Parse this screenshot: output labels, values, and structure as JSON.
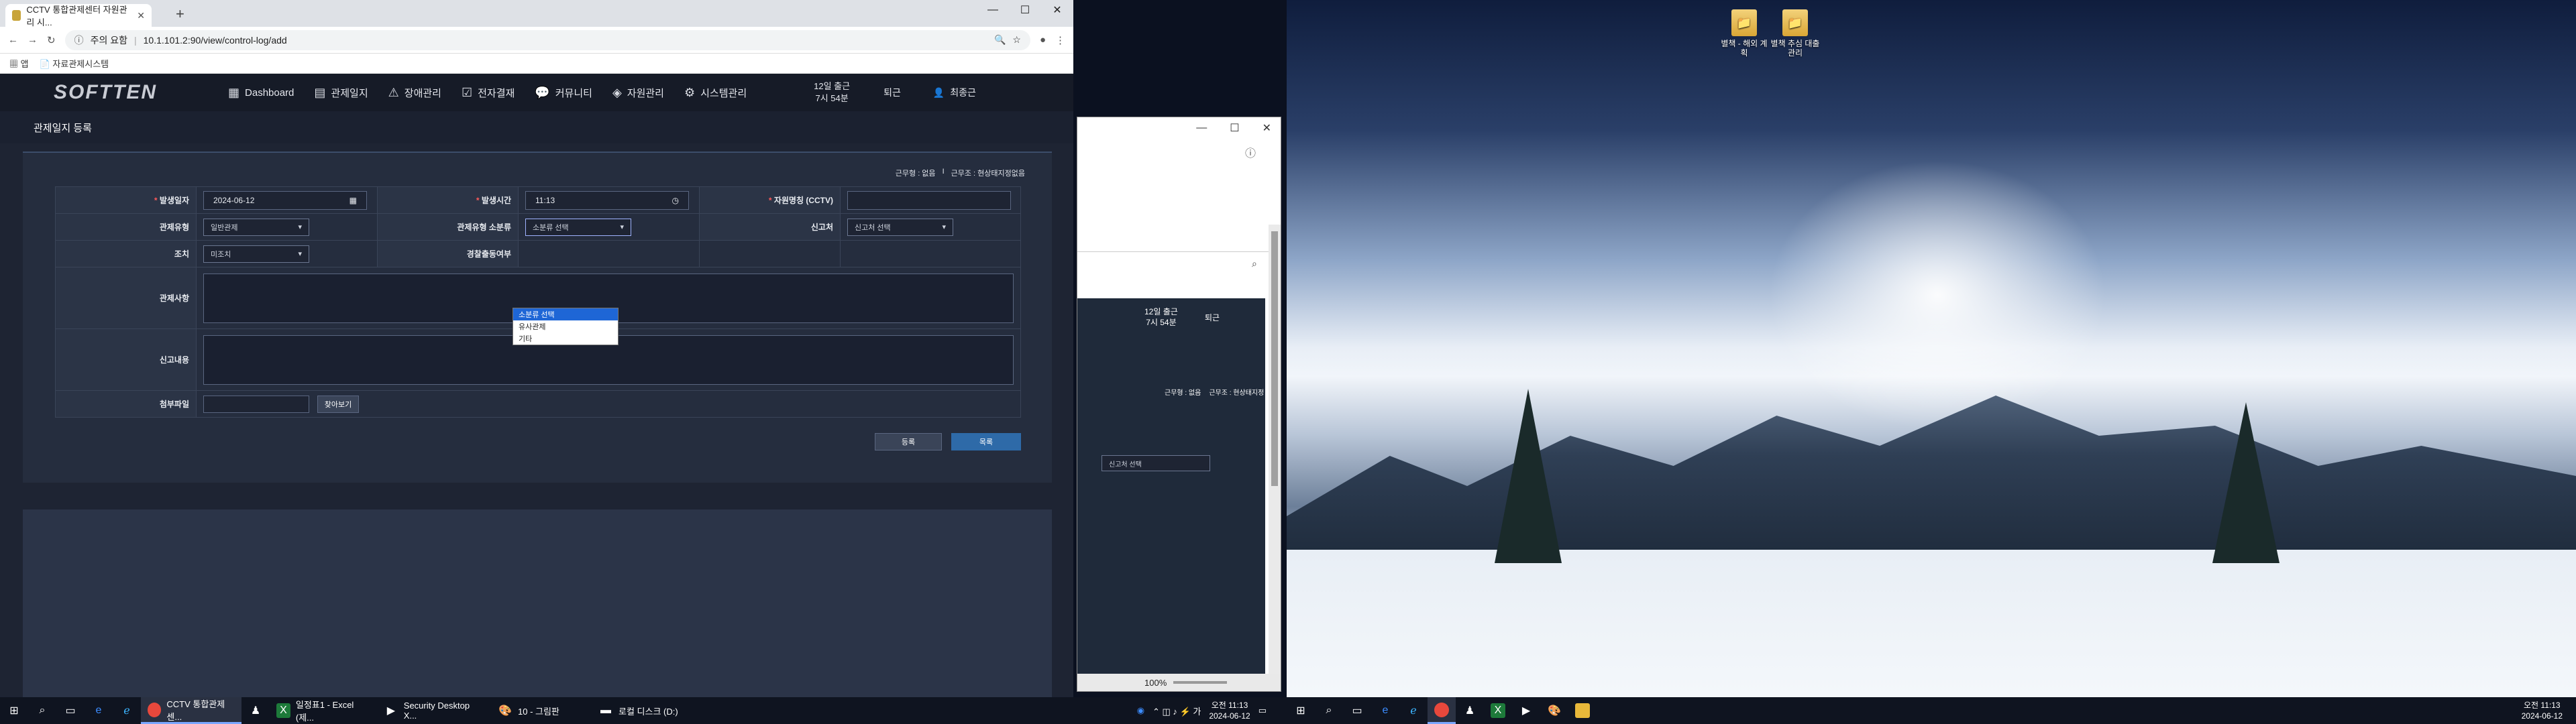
{
  "browser": {
    "tab_title": "CCTV 통합관제센터 자원관리 시...",
    "tab_close": "✕",
    "new_tab": "+",
    "win_min": "—",
    "win_max": "☐",
    "win_close": "✕",
    "security_label": "주의 요함",
    "url": "10.1.101.2:90/view/control-log/add",
    "bookmarks": [
      {
        "label": "앱"
      },
      {
        "label": "자료관제시스템"
      }
    ]
  },
  "app": {
    "logo": "SOFTTEN",
    "nav": [
      {
        "label": "Dashboard",
        "icon": "grid-icon"
      },
      {
        "label": "관제일지",
        "icon": "document-icon"
      },
      {
        "label": "장애관리",
        "icon": "warning-icon"
      },
      {
        "label": "전자결재",
        "icon": "check-icon"
      },
      {
        "label": "커뮤니티",
        "icon": "chat-icon"
      },
      {
        "label": "자원관리",
        "icon": "box-icon"
      },
      {
        "label": "시스템관리",
        "icon": "gear-icon"
      }
    ],
    "date_line1": "12일 출근",
    "date_line2": "7시 54분",
    "leave_label": "퇴근",
    "user_name": "최종근",
    "page_title": "관제일지 등록",
    "info_left": "근무형 : 없음",
    "info_sep": "I",
    "info_right": "근무조 : 현상태지정없음"
  },
  "form": {
    "date_label": "발생일자",
    "date_value": "2024-06-12",
    "time_label": "발생시간",
    "time_value": "11:13",
    "cctv_label": "자원명칭 (CCTV)",
    "type_label": "관제유형",
    "type_value": "일반관제",
    "subtype_label": "관제유형 소분류",
    "subtype_value": "소분류 선택",
    "reporter_label": "신고처",
    "reporter_value": "신고처 선택",
    "action_label": "조치",
    "action_value": "미조치",
    "police_label": "경찰출동여부",
    "content_label": "관제사항",
    "report_label": "신고내용",
    "attach_label": "첨부파일",
    "browse_label": "찾아보기",
    "register_label": "등록",
    "list_label": "목록",
    "dropdown_options": [
      "소분류 선택",
      "유사관제",
      "기타"
    ]
  },
  "midwindow": {
    "min": "—",
    "max": "☐",
    "close": "✕",
    "date_line1": "12일 출근",
    "date_line2": "7시 54분",
    "leave_label": "퇴근",
    "info_left": "근무형 : 없음",
    "info_right": "근무조 : 현상태지정",
    "reporter_value": "신고처 선택",
    "zoom": "100%",
    "search_icon": "search-icon"
  },
  "desktop": {
    "icons": [
      {
        "label": "별책 - 해외 계획"
      },
      {
        "label": "별책 추심 대출관리"
      }
    ]
  },
  "taskbar_left": {
    "items": [
      {
        "label": "CCTV 통합관제센..."
      },
      {
        "label": "일정표1 - Excel (제..."
      },
      {
        "label": "Security Desktop X..."
      },
      {
        "label": "10 - 그림판"
      },
      {
        "label": "로컬 디스크 (D:)"
      }
    ],
    "time": "오전 11:13",
    "date": "2024-06-12"
  },
  "taskbar_right": {
    "time": "오전 11:13",
    "date": "2024-06-12"
  }
}
